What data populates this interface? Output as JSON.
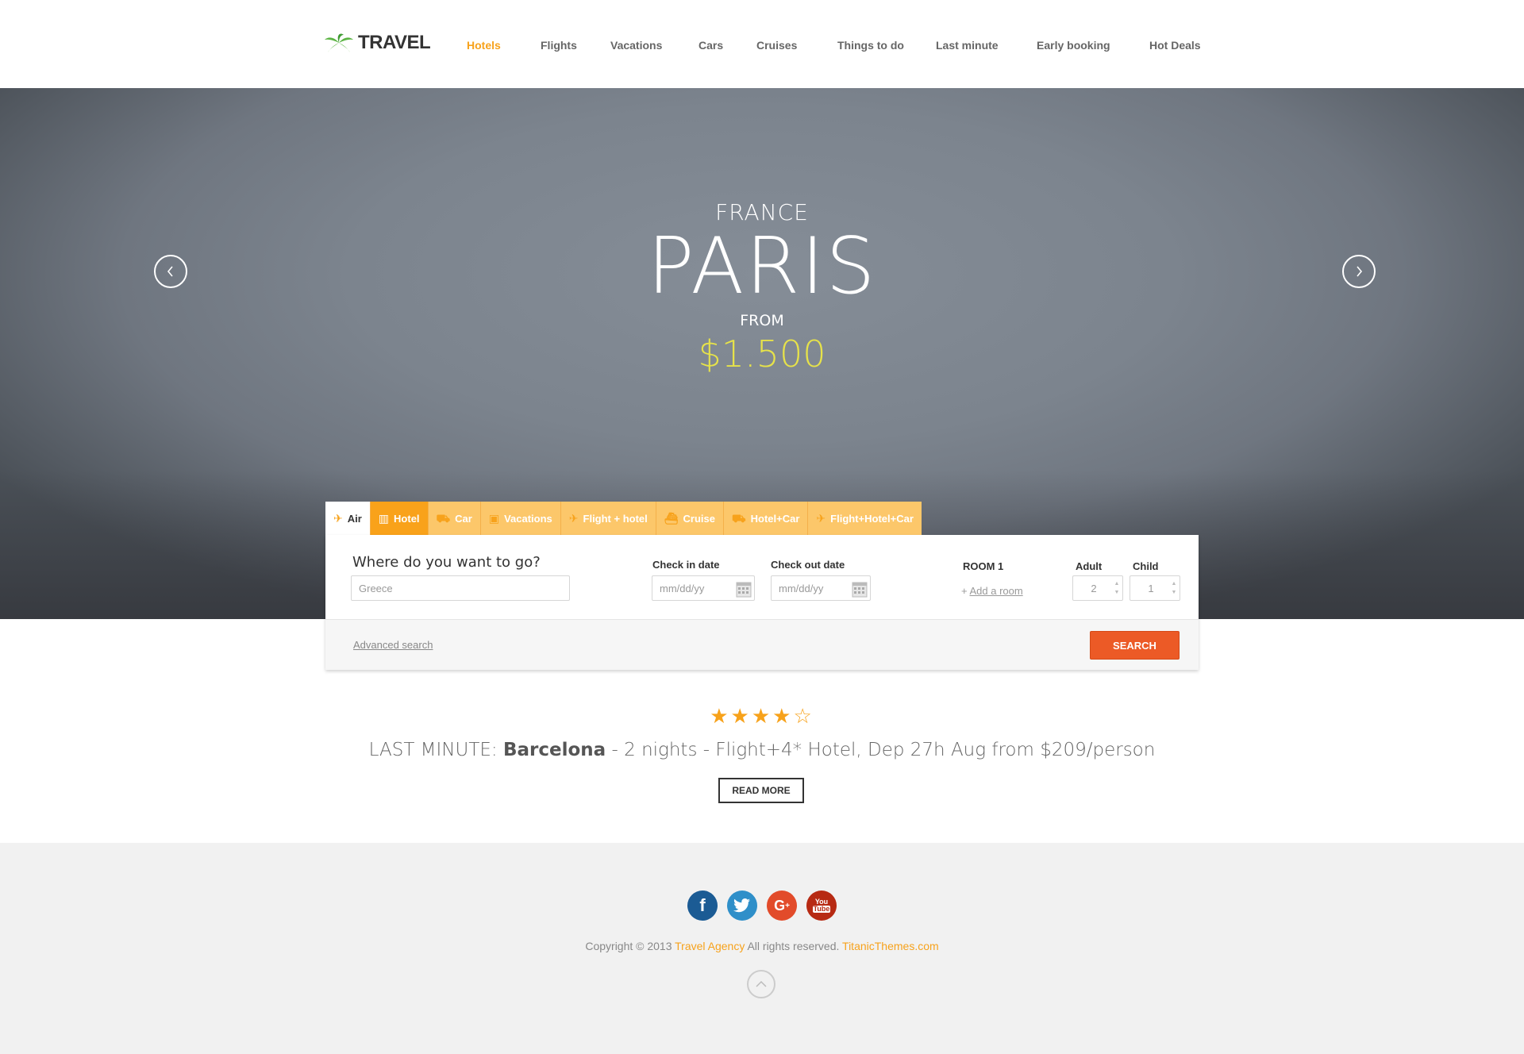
{
  "logo": {
    "text": "TRAVEL"
  },
  "nav": {
    "items": [
      {
        "label": "Hotels",
        "active": true
      },
      {
        "label": "Flights"
      },
      {
        "label": "Vacations"
      },
      {
        "label": "Cars"
      },
      {
        "label": "Cruises"
      },
      {
        "label": "Things to do"
      },
      {
        "label": "Last minute"
      },
      {
        "label": "Early booking"
      },
      {
        "label": "Hot Deals"
      }
    ]
  },
  "hero": {
    "country": "FRANCE",
    "city": "PARIS",
    "from": "FROM",
    "price": "$1.500"
  },
  "search": {
    "tabs": [
      {
        "label": "Air",
        "icon": "plane-icon",
        "state": "active"
      },
      {
        "label": "Hotel",
        "icon": "hotel-icon",
        "state": "selected"
      },
      {
        "label": "Car",
        "icon": "car-icon"
      },
      {
        "label": "Vacations",
        "icon": "suitcase-icon"
      },
      {
        "label": "Flight + hotel",
        "icon": "plane-icon"
      },
      {
        "label": "Cruise",
        "icon": "ship-icon"
      },
      {
        "label": "Hotel+Car",
        "icon": "car-icon"
      },
      {
        "label": "Flight+Hotel+Car",
        "icon": "combo-icon"
      }
    ],
    "where_label": "Where do you want to go?",
    "destination_value": "Greece",
    "checkin_label": "Check in date",
    "checkin_placeholder": "mm/dd/yy",
    "checkout_label": "Check out date",
    "checkout_placeholder": "mm/dd/yy",
    "room_label": "ROOM 1",
    "add_room_prefix": "+",
    "add_room_label": "Add a room",
    "adult_label": "Adult",
    "adult_value": "2",
    "child_label": "Child",
    "child_value": "1",
    "advanced_label": "Advanced search",
    "search_button": "SEARCH"
  },
  "promo": {
    "stars": "★★★★☆",
    "prefix": "LAST MINUTE: ",
    "city": "Barcelona",
    "details": " - 2 nights - Flight+4* Hotel, Dep 27h Aug from $209/person",
    "read_more": "READ MORE"
  },
  "footer": {
    "social": [
      "facebook-icon",
      "twitter-icon",
      "google-plus-icon",
      "youtube-icon"
    ],
    "copyright_prefix": "Copyright © 2013 ",
    "agency_link": "Travel Agency",
    "rights": " All rights reserved. ",
    "site_link": "TitanicThemes.com"
  },
  "colors": {
    "accent": "#f7a21b",
    "search_button": "#ec5a26",
    "price": "#e6e24a",
    "tab_bg": "#fcc76a"
  }
}
